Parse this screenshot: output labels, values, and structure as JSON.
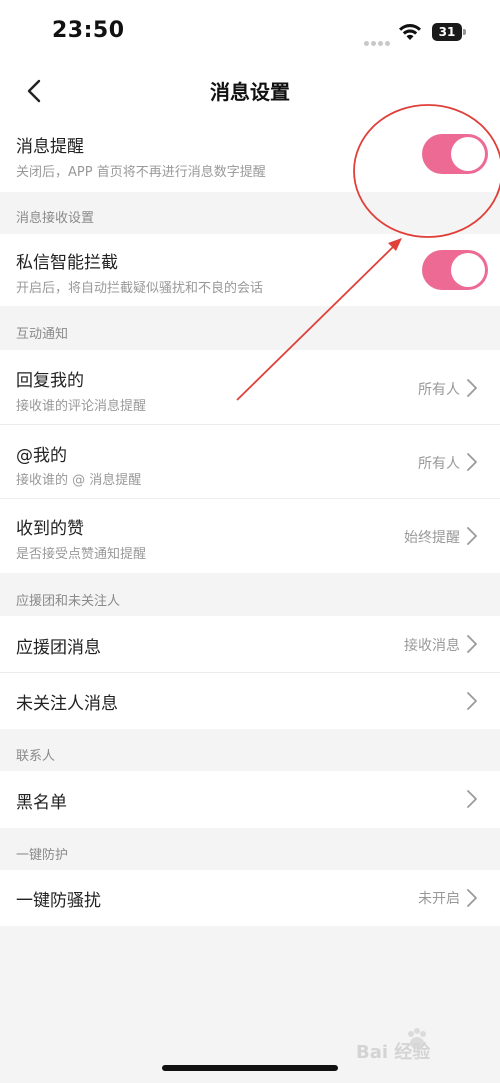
{
  "status": {
    "time": "23:50",
    "battery": "31"
  },
  "nav": {
    "title": "消息设置"
  },
  "notify": {
    "title": "消息提醒",
    "sub": "关闭后，APP 首页将不再进行消息数字提醒",
    "enabled": true
  },
  "receive_section": {
    "header": "消息接收设置"
  },
  "dm_filter": {
    "title": "私信智能拦截",
    "sub": "开启后，将自动拦截疑似骚扰和不良的会话",
    "enabled": true
  },
  "interaction_section": {
    "header": "互动通知"
  },
  "reply": {
    "title": "回复我的",
    "sub": "接收谁的评论消息提醒",
    "value": "所有人"
  },
  "mention": {
    "title": "@我的",
    "sub": "接收谁的 @ 消息提醒",
    "value": "所有人"
  },
  "likes": {
    "title": "收到的赞",
    "sub": "是否接受点赞通知提醒",
    "value": "始终提醒"
  },
  "fans_section": {
    "header": "应援团和未关注人"
  },
  "fan_group": {
    "title": "应援团消息",
    "value": "接收消息"
  },
  "stranger": {
    "title": "未关注人消息"
  },
  "contacts_section": {
    "header": "联系人"
  },
  "blacklist": {
    "title": "黑名单"
  },
  "protect_section": {
    "header": "一键防护"
  },
  "anti_harass": {
    "title": "一键防骚扰",
    "value": "未开启"
  },
  "colors": {
    "accent": "#ec6a94",
    "annotation": "#e0403a"
  },
  "watermark": {
    "text": "Bai 经验"
  }
}
